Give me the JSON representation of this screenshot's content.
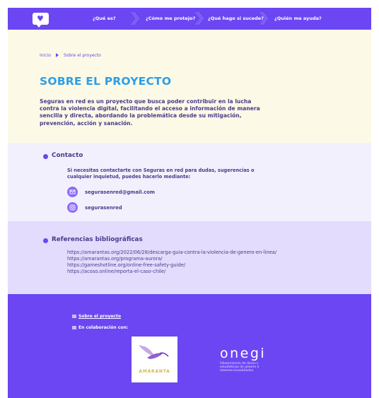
{
  "nav": {
    "items": [
      "¿Qué es?",
      "¿Cómo me protejo?",
      "¿Qué hago si sucede?",
      "¿Quién me ayuda?"
    ]
  },
  "breadcrumb": {
    "home": "Inicio",
    "current": "Sobre el proyecto"
  },
  "hero": {
    "title": "SOBRE EL PROYECTO",
    "text": "Seguras en red es un proyecto que busca poder contribuir en la lucha contra la violencia digital, facilitando el acceso a información de manera sencilla y directa, abordando la problemática desde su mitigación, prevención, acción y sanación."
  },
  "contact": {
    "title": "Contacto",
    "text": "Si necesitas contactarte con Seguras en red para dudas, sugerencias o cualquier inquietud, puedes hacerlo mediante:",
    "email": "segurasenred@gmail.com",
    "instagram": "segurasenred"
  },
  "references": {
    "title": "Referencias bibliográficas",
    "links": [
      "https://amarantas.org/2022/06/28/descarga-guia-contra-la-violencia-de-genero-en-linea/",
      "https://amarantas.org/programa-aurora/",
      "https://gameshotline.org/online-free-safety-guide/",
      "https://acoso.online/reporta-el-caso-chile/"
    ]
  },
  "footer": {
    "about_link": "Sobre el proyecto",
    "collab_label": "En colaboración con:",
    "amaranta_text": "AMARANTA",
    "onegi_name": "onegi",
    "onegi_sub": "Observatorio de datos y estadísticas de género e interseccionalidades"
  },
  "colors": {
    "primary": "#6b46f2",
    "title": "#2d9ee8",
    "text": "#4b3a8c",
    "hero_bg": "#fcfae6",
    "contact_bg": "#f3f0fe",
    "refs_bg": "#e3dcfd"
  }
}
